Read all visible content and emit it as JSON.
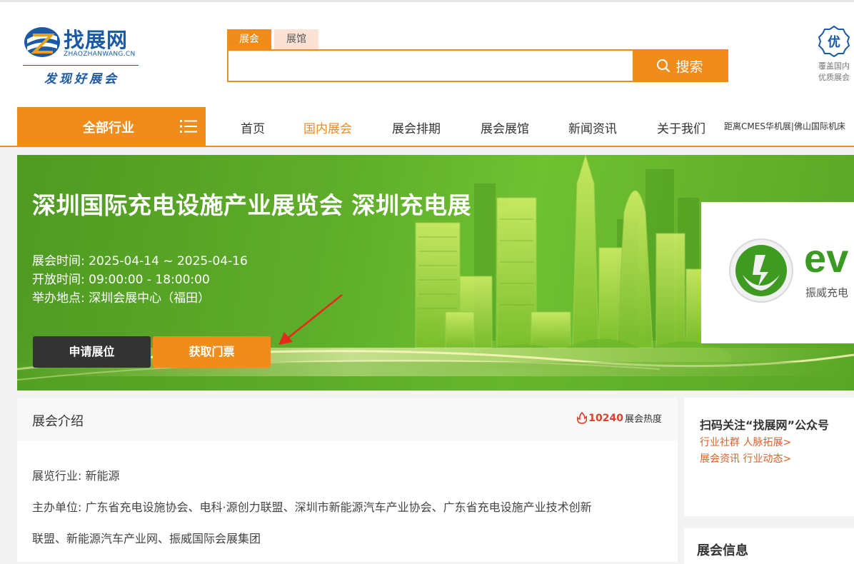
{
  "logo": {
    "name": "找展网",
    "pinyin": "ZHAOZHANWANG.CN",
    "slogan": "发现好展会"
  },
  "search": {
    "tabs": [
      {
        "label": "展会",
        "active": true
      },
      {
        "label": "展馆",
        "active": false
      }
    ],
    "placeholder": "",
    "button_label": "搜索"
  },
  "badge": {
    "icon_char": "优",
    "line1": "覆盖国内",
    "line2": "优质展会"
  },
  "nav": {
    "all_industries": "全部行业",
    "items": [
      {
        "label": "首页",
        "active": false
      },
      {
        "label": "国内展会",
        "active": true
      },
      {
        "label": "展会排期",
        "active": false
      },
      {
        "label": "展会展馆",
        "active": false
      },
      {
        "label": "新闻资讯",
        "active": false
      },
      {
        "label": "关于我们",
        "active": false
      }
    ],
    "ticker": "距离CMES华机展|佛山国际机床"
  },
  "banner": {
    "title": "深圳国际充电设施产业展览会 深圳充电展",
    "time": "展会时间:  2025-04-14 ~ 2025-04-16",
    "open_hours": "开放时间:  09:00:00 - 18:00:00",
    "location": "举办地点:  深圳会展中心（福田）",
    "apply_button": "申请展位",
    "ticket_button": "获取门票",
    "sponsor_logo_text": "ev",
    "sponsor_cn": "振威充电"
  },
  "intro": {
    "title": "展会介绍",
    "heat_value": "10240",
    "heat_label": "展会热度",
    "industry": "展览行业:  新能源",
    "organizer_line1": "主办单位:  广东省充电设施协会、电科·源创力联盟、深圳市新能源汽车产业协会、广东省充电设施产业技术创新",
    "organizer_line2": "联盟、新能源汽车产业网、振威国际会展集团"
  },
  "sidebar": {
    "qr_title": "扫码关注“找展网”公众号",
    "link1": "行业社群 人脉拓展>",
    "link2": "展会资讯 行业动态>",
    "info_title": "展会信息"
  },
  "colors": {
    "accent": "#f08c1a",
    "brand_blue": "#1a5aa6",
    "banner_green": "#5fae2a",
    "heat_red": "#d9412a"
  }
}
